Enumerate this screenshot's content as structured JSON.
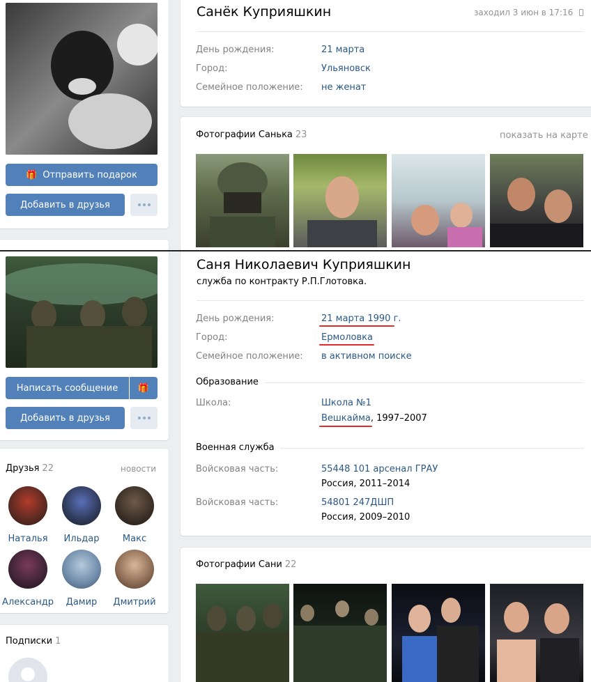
{
  "top_profile": {
    "name": "Санёк Куприяшкин",
    "last_seen": "заходил 3 июн в 17:16",
    "buttons": {
      "gift": "Отправить подарок",
      "add_friend": "Добавить в друзья"
    },
    "info": [
      {
        "label": "День рождения:",
        "value": "21 марта"
      },
      {
        "label": "Город:",
        "value": "Ульяновск"
      },
      {
        "label": "Семейное положение:",
        "value": "не женат"
      }
    ],
    "photos": {
      "title": "Фотографии Санька",
      "count": "23",
      "map_link": "показать на карте"
    }
  },
  "bottom_profile": {
    "name": "Саня Николаевич Куприяшкин",
    "status": "служба по контракту Р.П.Глотовка.",
    "buttons": {
      "message": "Написать сообщение",
      "add_friend": "Добавить в друзья"
    },
    "info": [
      {
        "label": "День рождения:",
        "value": "21 марта 1990 г."
      },
      {
        "label": "Город:",
        "value": "Ермоловка"
      },
      {
        "label": "Семейное положение:",
        "value": "в активном поиске"
      }
    ],
    "education": {
      "title": "Образование",
      "school_label": "Школа:",
      "school_name": "Школа №1",
      "school_city": "Вешкайма",
      "school_years": ", 1997–2007"
    },
    "military": {
      "title": "Военная служба",
      "units": [
        {
          "label": "Войсковая часть:",
          "name": "55448 101 арсенал ГРАУ",
          "details": "Россия, 2011–2014"
        },
        {
          "label": "Войсковая часть:",
          "name": "54801 247ДШП",
          "details": "Россия, 2009–2010"
        }
      ]
    },
    "friends": {
      "title": "Друзья",
      "count": "22",
      "news_link": "новости",
      "list": [
        {
          "name": "Наталья"
        },
        {
          "name": "Ильдар"
        },
        {
          "name": "Макс"
        },
        {
          "name": "Александр"
        },
        {
          "name": "Дамир"
        },
        {
          "name": "Дмитрий"
        }
      ]
    },
    "subscriptions": {
      "title": "Подписки",
      "count": "1"
    },
    "photos": {
      "title": "Фотографии Сани",
      "count": "22"
    }
  },
  "colors": {
    "accent": "#5181b8",
    "link": "#2a5885",
    "underline": "#e12b2b",
    "background": "#edeef0"
  }
}
